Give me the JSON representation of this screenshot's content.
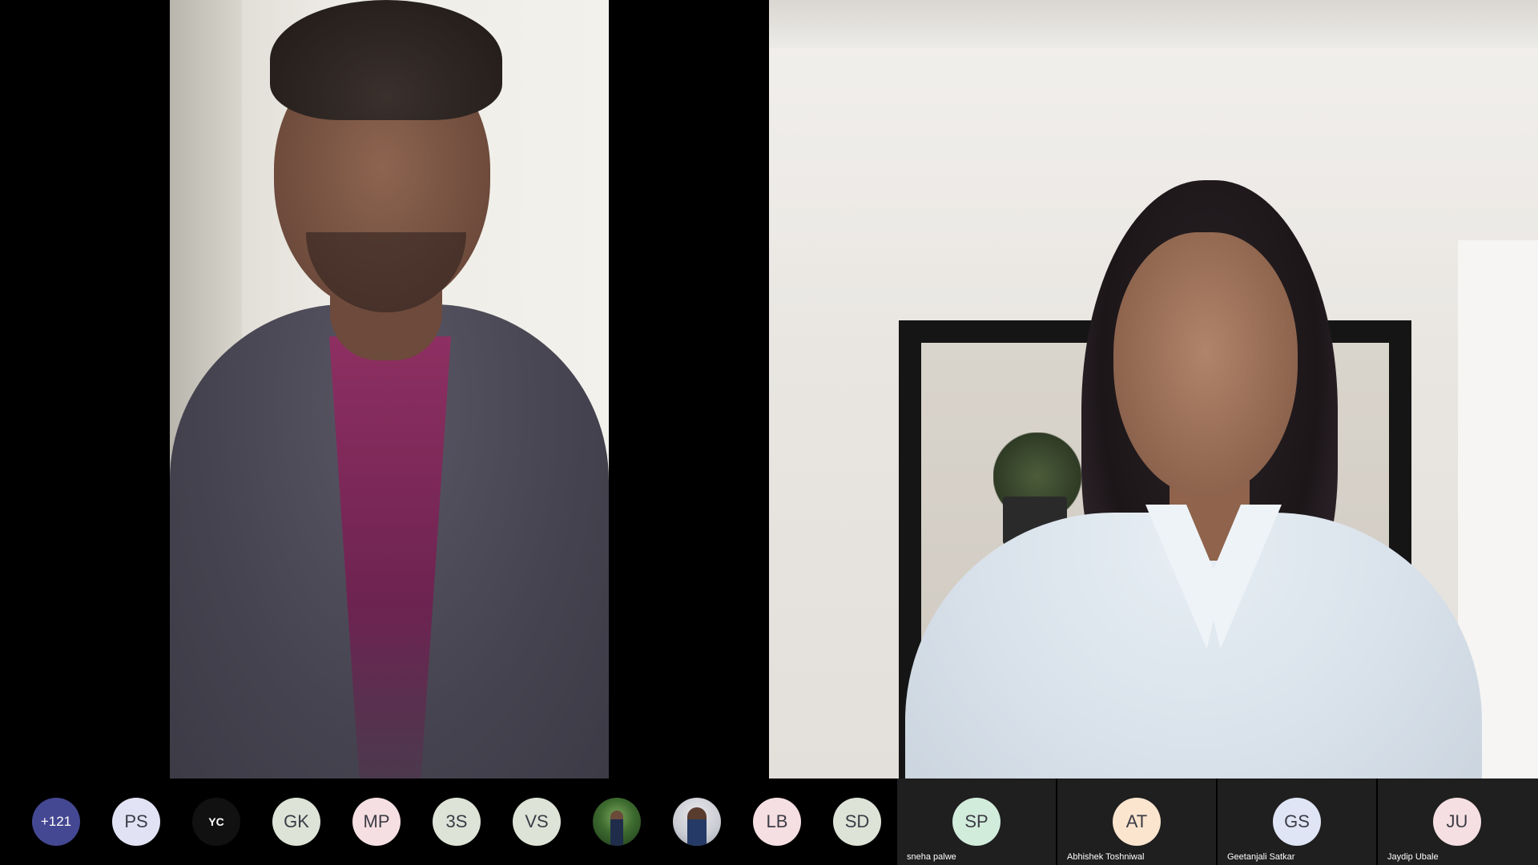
{
  "call": {
    "participants_overflow": "+121",
    "strip_avatars": [
      {
        "initials": "PS",
        "bg": "#e2e2f5"
      },
      {
        "initials": "YC",
        "bg": "#111111"
      },
      {
        "initials": "GK",
        "bg": "#dde3d7"
      },
      {
        "initials": "MP",
        "bg": "#f5dfe2"
      },
      {
        "initials": "3S",
        "bg": "#dde3d7"
      },
      {
        "initials": "VS",
        "bg": "#dde3d7"
      },
      {
        "initials": "",
        "photo": "photo-avatar-green"
      },
      {
        "initials": "",
        "photo": "photo-avatar-man"
      },
      {
        "initials": "LB",
        "bg": "#f5dfe2"
      },
      {
        "initials": "SD",
        "bg": "#dde3d7"
      }
    ],
    "named_tiles": [
      {
        "initials": "SP",
        "name": "sneha palwe",
        "bg": "#d2ecdc"
      },
      {
        "initials": "AT",
        "name": "Abhishek Toshniwal",
        "bg": "#fbe5cf"
      },
      {
        "initials": "GS",
        "name": "Geetanjali Satkar",
        "bg": "#dfe5f5"
      },
      {
        "initials": "JU",
        "name": "Jaydip Ubale",
        "bg": "#f5dfe2"
      }
    ],
    "overflow_bg": "#444791"
  }
}
